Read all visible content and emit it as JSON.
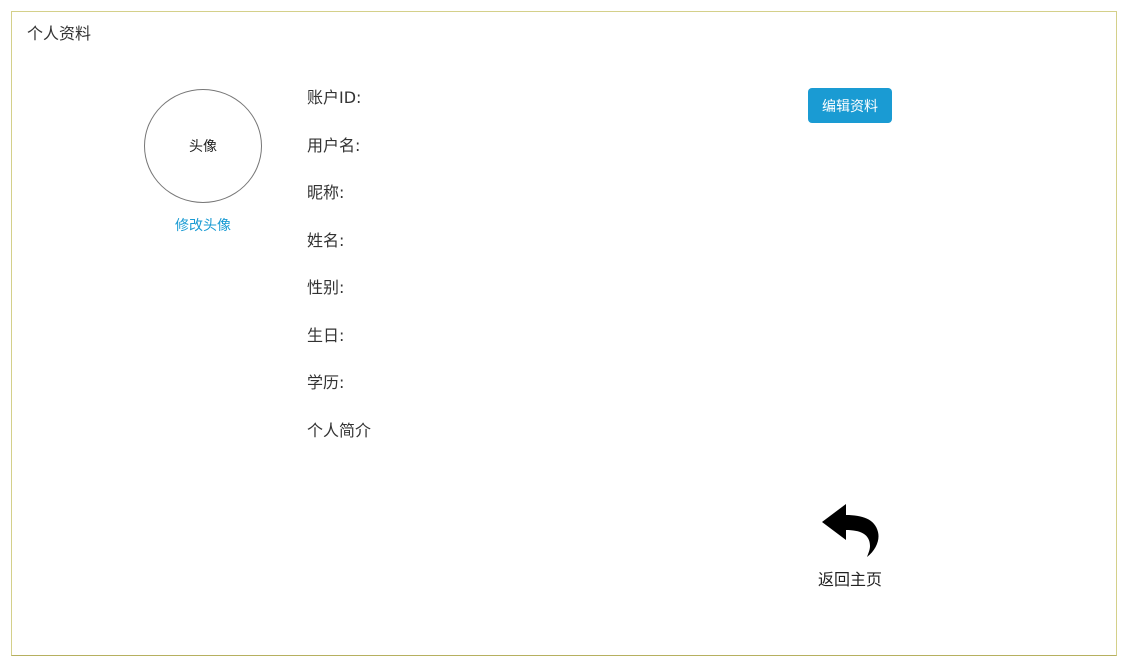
{
  "page": {
    "title": "个人资料"
  },
  "avatar": {
    "placeholder_text": "头像",
    "change_link": "修改头像"
  },
  "profile_fields": [
    {
      "label": "账户ID:"
    },
    {
      "label": "用户名:"
    },
    {
      "label": "昵称:"
    },
    {
      "label": "姓名:"
    },
    {
      "label": "性别:"
    },
    {
      "label": "生日:"
    },
    {
      "label": "学历:"
    },
    {
      "label": "个人简介"
    }
  ],
  "actions": {
    "edit_label": "编辑资料",
    "back_home_label": "返回主页",
    "back_home_icon": "reply-arrow-icon"
  },
  "colors": {
    "accent": "#1a9bd3",
    "frame_border": "#d4d08a",
    "text": "#333333"
  }
}
